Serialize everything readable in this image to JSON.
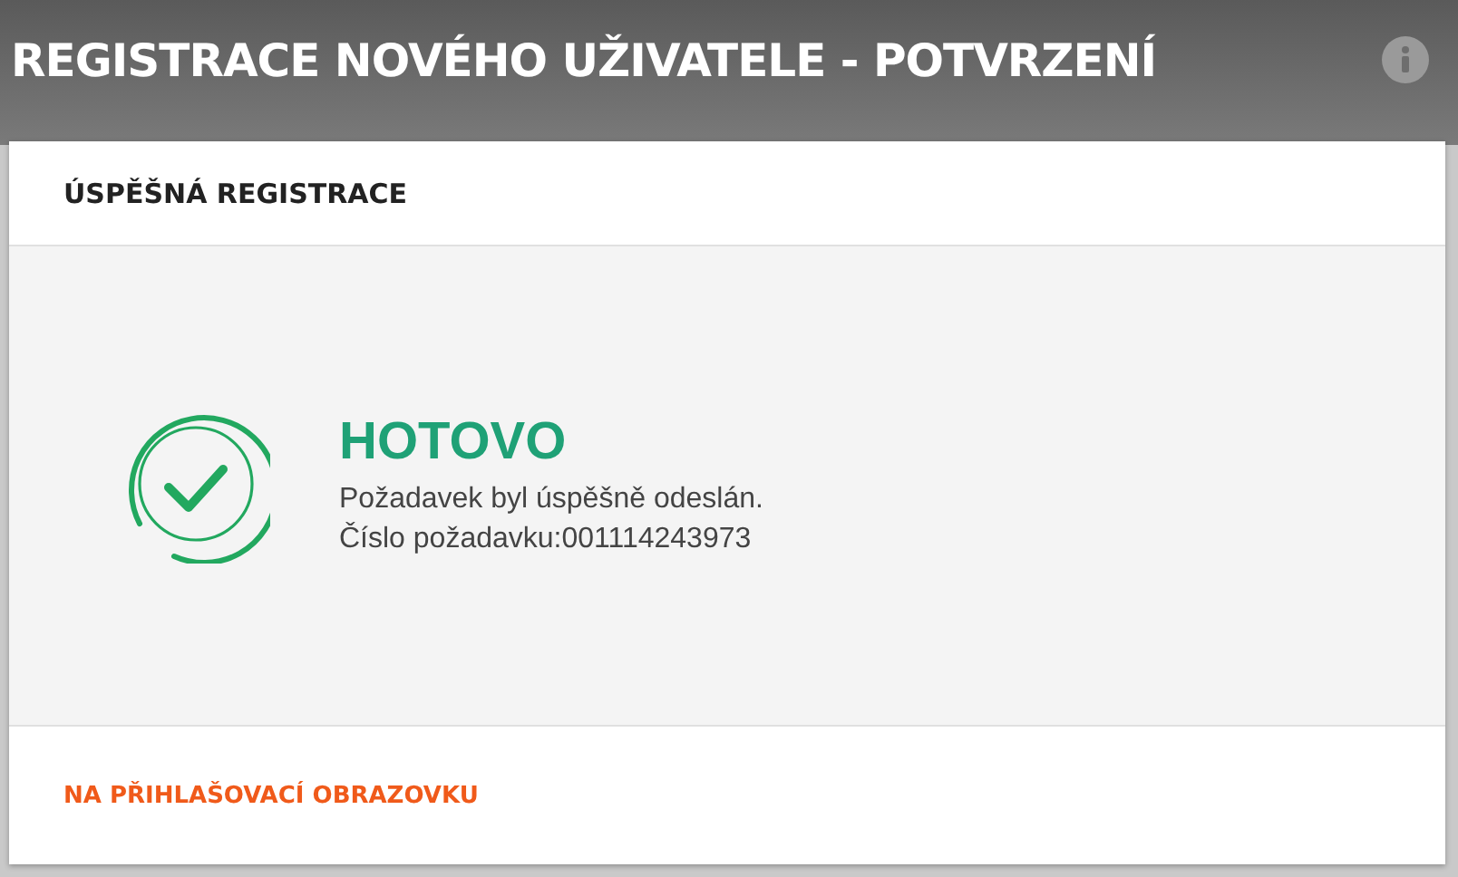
{
  "header": {
    "title": "REGISTRACE NOVÉHO UŽIVATELE - POTVRZENÍ"
  },
  "card": {
    "title": "ÚSPĚŠNÁ REGISTRACE",
    "status": "HOTOVO",
    "lines": [
      "Požadavek byl úspěšně odeslán.",
      "Číslo požadavku:001114243973"
    ],
    "link": "NA PŘIHLAŠOVACÍ OBRAZOVKU"
  }
}
